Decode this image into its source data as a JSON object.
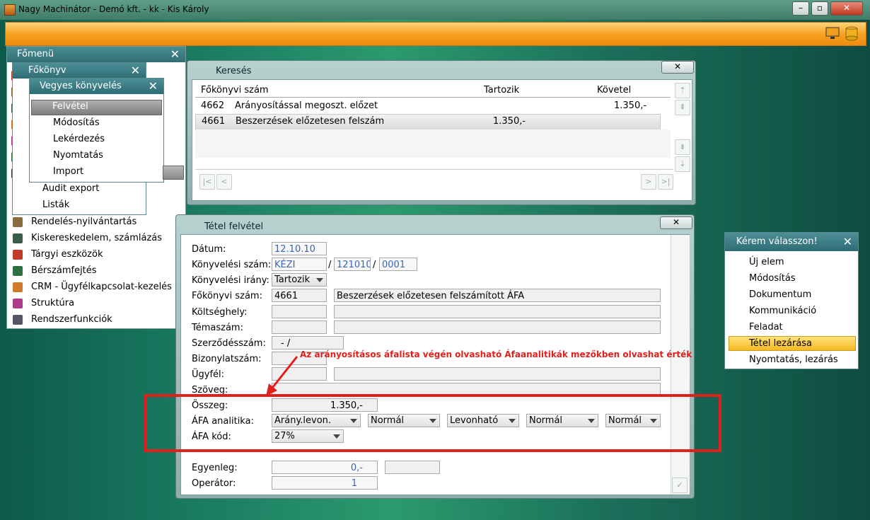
{
  "window": {
    "title": "Nagy Machinátor - Demó kft. - kk - Kis Károly",
    "minimize": "–",
    "maximize": "▫",
    "close": "✕"
  },
  "mainmenu": {
    "title": "Főmenü",
    "items": [
      {
        "label": "Rendelés-nyilvántartás",
        "icon": "boxes-icon",
        "color": "#8a6b3e"
      },
      {
        "label": "Kiskereskedelem, számlázás",
        "icon": "cash-register-icon",
        "color": "#3b5e4a"
      },
      {
        "label": "Tárgyi eszközök",
        "icon": "assets-icon",
        "color": "#c0392b"
      },
      {
        "label": "Bérszámfejtés",
        "icon": "payroll-icon",
        "color": "#2e6f3f"
      },
      {
        "label": "CRM - Ügyfélkapcsolat-kezelés",
        "icon": "crm-icon",
        "color": "#d07a2a"
      },
      {
        "label": "Struktúra",
        "icon": "structure-icon",
        "color": "#b03a8a"
      },
      {
        "label": "Rendszerfunkciók",
        "icon": "settings-icon",
        "color": "#556"
      }
    ]
  },
  "fokonyv": {
    "title": "Főkönyv",
    "items": [
      {
        "label": "Audit export"
      },
      {
        "label": "Listák"
      }
    ]
  },
  "vegyes": {
    "title": "Vegyes könyvelés",
    "items": [
      {
        "label": "Felvétel"
      },
      {
        "label": "Módosítás"
      },
      {
        "label": "Lekérdezés"
      },
      {
        "label": "Nyomtatás"
      },
      {
        "label": "Import"
      }
    ]
  },
  "search": {
    "title": "Keresés",
    "close": "✕",
    "columns": [
      "Főkönyvi szám",
      "Tartozik",
      "Követel"
    ],
    "rows": [
      {
        "code": "4662",
        "name": "Arányosítással megoszt. előzet",
        "tartozik": "",
        "kovetel": "1.350,-"
      },
      {
        "code": "4661",
        "name": "Beszerzések előzetesen felszám",
        "tartozik": "1.350,-",
        "kovetel": ""
      }
    ],
    "nav": {
      "first": "|<",
      "prev": "<",
      "next": ">",
      "last": ">|",
      "up_top": "⇡",
      "up": "⇞",
      "down": "⇟",
      "down_bottom": "⇣"
    }
  },
  "tetel": {
    "title": "Tétel felvétel",
    "close": "✕",
    "labels": {
      "datum": "Dátum:",
      "konyvszam": "Könyvelési szám:",
      "irany": "Könyvelési irány:",
      "fokonyv": "Főkönyvi szám:",
      "koltseg": "Költséghely:",
      "tema": "Témaszám:",
      "szerzodes": "Szerződésszám:",
      "bizonylat": "Bizonylatszám:",
      "ugyfel": "Ügyfél:",
      "szoveg": "Szöveg:",
      "osszeg": "Összeg:",
      "afa_analitika": "ÁFA analitika:",
      "afa_kod": "ÁFA kód:",
      "egyenleg": "Egyenleg:",
      "operator": "Operátor:"
    },
    "values": {
      "datum": "12.10.10",
      "konyv_prefix": "KÉZI",
      "konyv_sep1": "/",
      "konyv_mid": "121010",
      "konyv_sep2": "/",
      "konyv_suffix": "0001",
      "irany": "Tartozik",
      "fokonyv_code": "4661",
      "fokonyv_name": "Beszerzések előzetesen felszámított ÁFA",
      "szerzodes": "-  /",
      "osszeg": "1.350,-",
      "afa_analitika": [
        "Arány.levon.",
        "Normál",
        "Levonható",
        "Normál",
        "Normál"
      ],
      "afa_kod": "27%",
      "egyenleg": "0,-",
      "operator": "1",
      "ok": "✓"
    },
    "annotation": "Az arányosításos áfalista végén olvasható Áfaanalitikák mezőkben olvashat érték",
    "annotation_color": "#e0201b"
  },
  "choose": {
    "title": "Kérem válasszon!",
    "close": "✕",
    "items": [
      {
        "label": "Új elem"
      },
      {
        "label": "Módosítás"
      },
      {
        "label": "Dokumentum"
      },
      {
        "label": "Kommunikáció"
      },
      {
        "label": "Feladat"
      },
      {
        "label": "Tétel lezárása"
      },
      {
        "label": "Nyomtatás, lezárás"
      }
    ],
    "selected": "Tétel lezárása"
  }
}
